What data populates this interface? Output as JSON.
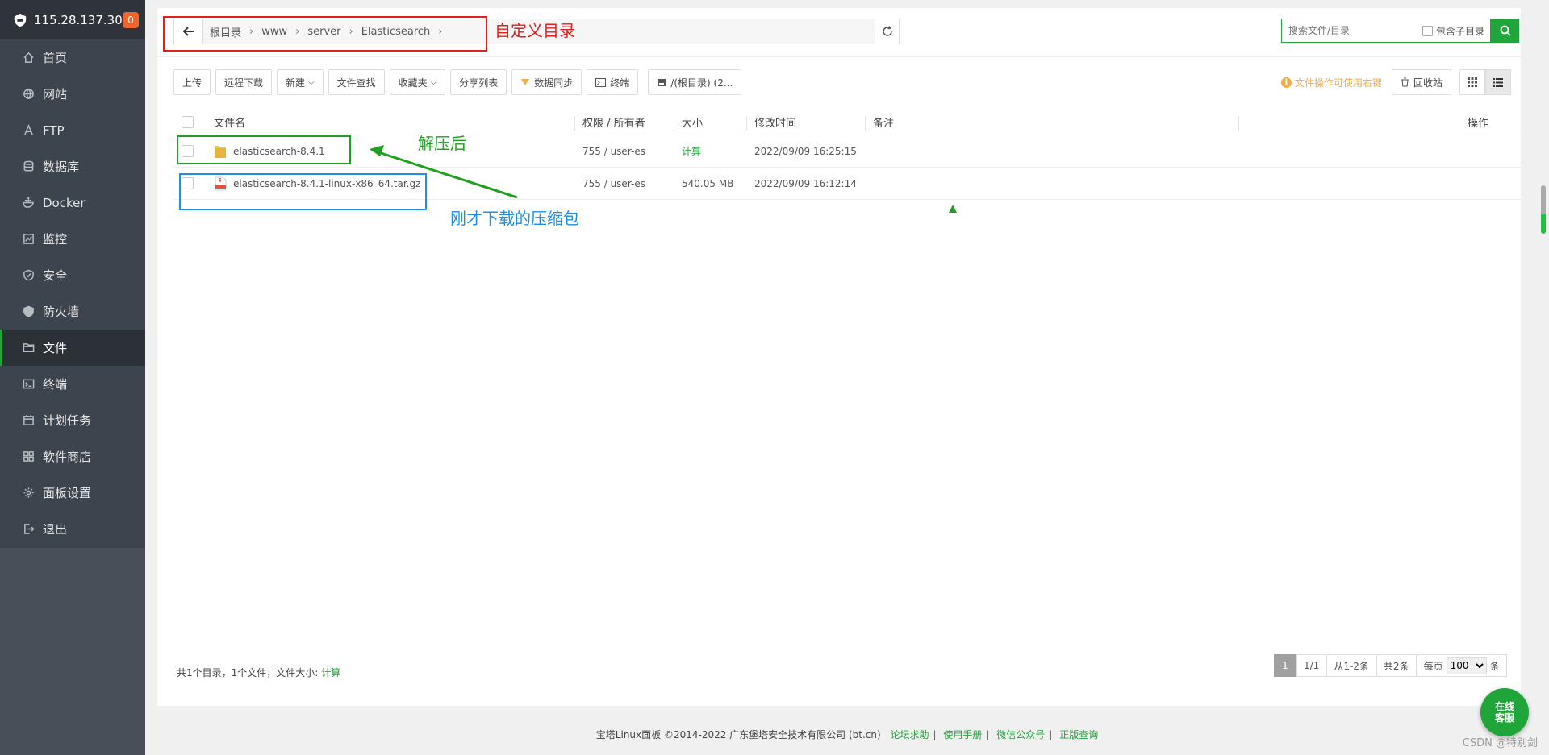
{
  "sidebar": {
    "ip": "115.28.137.30",
    "badge": "0",
    "items": [
      {
        "label": "首页",
        "icon": "home-icon"
      },
      {
        "label": "网站",
        "icon": "globe-icon"
      },
      {
        "label": "FTP",
        "icon": "ftp-icon"
      },
      {
        "label": "数据库",
        "icon": "database-icon"
      },
      {
        "label": "Docker",
        "icon": "docker-icon"
      },
      {
        "label": "监控",
        "icon": "monitor-icon"
      },
      {
        "label": "安全",
        "icon": "shield-icon"
      },
      {
        "label": "防火墙",
        "icon": "firewall-icon"
      },
      {
        "label": "文件",
        "icon": "folder-icon"
      },
      {
        "label": "终端",
        "icon": "terminal-icon"
      },
      {
        "label": "计划任务",
        "icon": "calendar-icon"
      },
      {
        "label": "软件商店",
        "icon": "apps-icon"
      },
      {
        "label": "面板设置",
        "icon": "gear-icon"
      },
      {
        "label": "退出",
        "icon": "logout-icon"
      }
    ]
  },
  "path": {
    "crumbs": [
      "根目录",
      "www",
      "server",
      "Elasticsearch"
    ]
  },
  "search": {
    "placeholder": "搜索文件/目录",
    "subdir_label": "包含子目录"
  },
  "toolbar": {
    "upload": "上传",
    "remote_download": "远程下载",
    "new": "新建",
    "find": "文件查找",
    "favorites": "收藏夹",
    "share_list": "分享列表",
    "data_sync": "数据同步",
    "terminal": "终端",
    "disk": "/(根目录) (2..."
  },
  "right_tools": {
    "tip": "文件操作可使用右键",
    "recycle": "回收站"
  },
  "table": {
    "headers": {
      "name": "文件名",
      "perm": "权限 / 所有者",
      "size": "大小",
      "mtime": "修改时间",
      "note": "备注",
      "op": "操作"
    },
    "rows": [
      {
        "name": "elasticsearch-8.4.1",
        "perm": "755 / user-es",
        "size": "计算",
        "mtime": "2022/09/09 16:25:15",
        "type": "folder"
      },
      {
        "name": "elasticsearch-8.4.1-linux-x86_64.tar.gz",
        "perm": "755 / user-es",
        "size": "540.05 MB",
        "mtime": "2022/09/09 16:12:14",
        "type": "archive"
      }
    ]
  },
  "summary": {
    "text": "共1个目录，1个文件，文件大小:",
    "link": "计算"
  },
  "pager": {
    "current": "1",
    "total_pages": "1/1",
    "range": "从1-2条",
    "count": "共2条",
    "per_page_label": "每页",
    "per_page": "100",
    "unit": "条"
  },
  "footer": {
    "copyright": "宝塔Linux面板 ©2014-2022 广东堡塔安全技术有限公司 (bt.cn)",
    "links": [
      "论坛求助",
      "使用手册",
      "微信公众号",
      "正版查询"
    ]
  },
  "service_button": "在线\n客服",
  "watermark": "CSDN @特别剑",
  "annotations": {
    "custom_dir": "自定义目录",
    "after_extract": "解压后",
    "downloaded_archive": "刚才下载的压缩包"
  },
  "colors": {
    "brand": "#20a53a",
    "sidebar": "#3c444d",
    "annotation_red": "#e02020",
    "annotation_green": "#20a020",
    "annotation_blue": "#1f8fe6"
  }
}
